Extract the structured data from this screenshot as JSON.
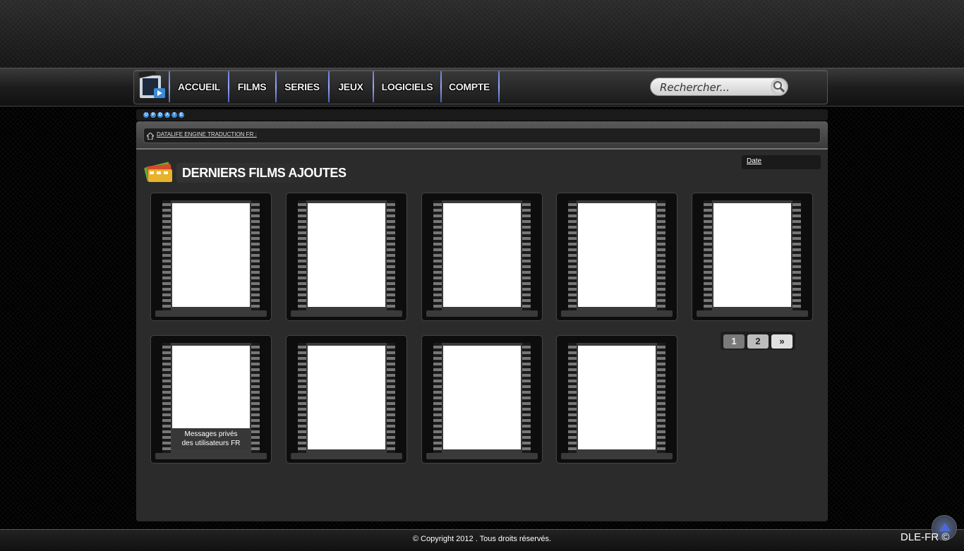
{
  "nav": {
    "items": [
      "ACCUEIL",
      "FILMS",
      "SERIES",
      "JEUX",
      "LOGICIELS",
      "COMPTE"
    ]
  },
  "search": {
    "placeholder": "Rechercher..."
  },
  "update_badge": [
    "U",
    "P",
    "D",
    "A",
    "T",
    "E"
  ],
  "breadcrumb": "DATALIFE ENGINE TRADUCTION FR :",
  "section": {
    "title": "DERNIERS FILMS AJOUTES",
    "sort_label": "Date"
  },
  "cards": [
    {
      "caption": ""
    },
    {
      "caption": ""
    },
    {
      "caption": ""
    },
    {
      "caption": ""
    },
    {
      "caption": ""
    },
    {
      "caption_line1": "Messages privés",
      "caption_line2": "des utilisateurs FR"
    },
    {
      "caption": ""
    },
    {
      "caption": ""
    },
    {
      "caption": ""
    }
  ],
  "pagination": {
    "page1": "1",
    "page2": "2",
    "next": "»"
  },
  "footer": {
    "copyright": "© Copyright 2012 . Tous droits réservés.",
    "brand": "DLE-FR ©"
  },
  "colors": {
    "accent": "#3a8ad8",
    "panel": "#2b2b2b"
  }
}
